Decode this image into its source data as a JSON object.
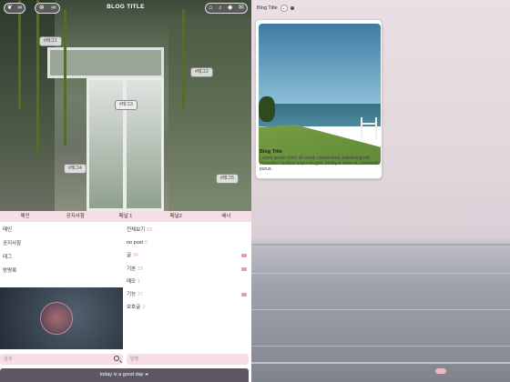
{
  "header": {
    "blog_title": "BLOG TITLE",
    "left_pill_icons": [
      "leaf-icon",
      "link-icon"
    ],
    "right_pill_icons": [
      "home-icon",
      "bell-icon",
      "tag-icon",
      "mail-icon"
    ]
  },
  "photo_tags": [
    "#태그1",
    "#태그2",
    "#태그3",
    "#태그4",
    "#태그5"
  ],
  "nav": {
    "items": [
      "메인",
      "공지사항",
      "패널 1",
      "패널2",
      "배너"
    ]
  },
  "menu_left": [
    "메인",
    "공지사항",
    "태그",
    "방명록"
  ],
  "categories": [
    {
      "label": "전체보기",
      "count": "53"
    },
    {
      "label": "no post",
      "count": "0"
    },
    {
      "label": "글",
      "count": "24"
    },
    {
      "label": "기본",
      "count": "23"
    },
    {
      "label": "메모",
      "count": "1"
    },
    {
      "label": "기능",
      "count": "27"
    },
    {
      "label": "보호글",
      "count": "3"
    }
  ],
  "search": {
    "placeholder": "검색"
  },
  "guestbook": {
    "placeholder": "방명"
  },
  "footer": {
    "text": "today is a good day ⏶"
  },
  "right": {
    "blog_title_label": "Blog Title",
    "card": {
      "title": "Blog Title",
      "description": "Lorem ipsum dolor sit amet, consectetur adipiscing elit. Phasellus facilisis turpis feugiat, tristique enim et, commodo purus."
    }
  },
  "colors": {
    "accent_pink": "#f7dde4",
    "footer_bg": "#5d5862",
    "count_pink": "#e89aa8"
  }
}
